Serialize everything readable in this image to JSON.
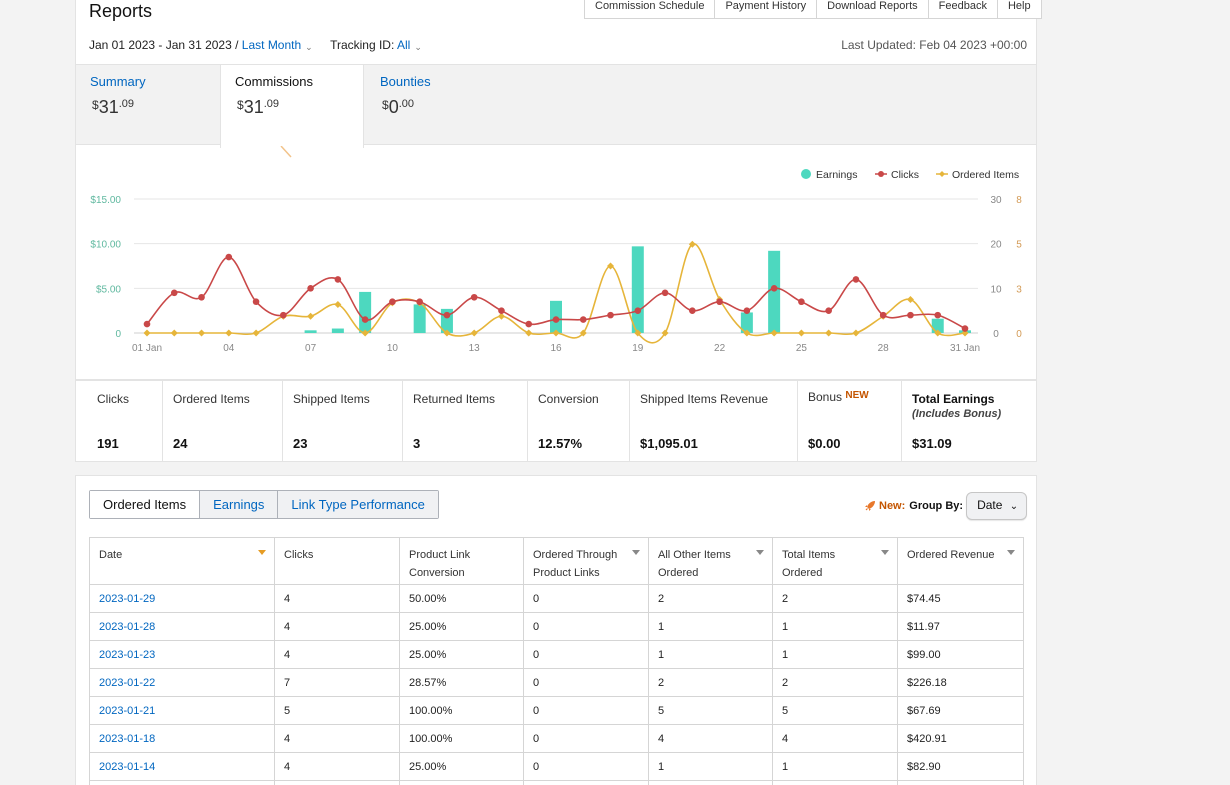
{
  "header": {
    "title": "Reports",
    "links": [
      "Commission Schedule",
      "Payment History",
      "Download Reports",
      "Feedback",
      "Help"
    ],
    "date_range": "Jan 01 2023 - Jan 31 2023 /",
    "date_preset": "Last Month",
    "tracking_label": "Tracking ID:",
    "tracking_value": "All",
    "last_updated": "Last Updated: Feb 04 2023 +00:00"
  },
  "summary_tabs": [
    {
      "label": "Summary",
      "currency": "$",
      "whole": "31",
      "cents": ".09"
    },
    {
      "label": "Commissions",
      "currency": "$",
      "whole": "31",
      "cents": ".09"
    },
    {
      "label": "Bounties",
      "currency": "$",
      "whole": "0",
      "cents": ".00"
    }
  ],
  "chart_data": {
    "type": "line",
    "legend": [
      "Earnings",
      "Clicks",
      "Ordered Items"
    ],
    "legend_position": "top-right",
    "x_tick_labels": [
      "01 Jan",
      "04",
      "07",
      "10",
      "13",
      "16",
      "19",
      "22",
      "25",
      "28",
      "31 Jan"
    ],
    "x": [
      1,
      2,
      3,
      4,
      5,
      6,
      7,
      8,
      9,
      10,
      11,
      12,
      13,
      14,
      15,
      16,
      17,
      18,
      19,
      20,
      21,
      22,
      23,
      24,
      25,
      26,
      27,
      28,
      29,
      30,
      31
    ],
    "y_left_ticks": [
      "$15.00",
      "$10.00",
      "$5.00",
      "0"
    ],
    "y_left_range": [
      0,
      15
    ],
    "y_right1_ticks": [
      "30",
      "20",
      "10",
      "0"
    ],
    "y_right1_range": [
      0,
      30
    ],
    "y_right2_ticks": [
      "8",
      "5",
      "3",
      "0"
    ],
    "y_right2_range": [
      0,
      8
    ],
    "grid": true,
    "series": [
      {
        "name": "Earnings",
        "type": "bar",
        "color": "#4dd8bf",
        "axis": "left",
        "values": [
          0,
          0,
          0,
          0,
          0,
          0,
          0.3,
          0.5,
          4.6,
          0,
          3.2,
          2.7,
          0,
          0,
          0,
          3.6,
          0,
          0,
          9.7,
          0,
          0,
          0,
          2.3,
          9.2,
          0,
          0,
          0,
          0,
          0,
          1.6,
          0.3
        ]
      },
      {
        "name": "Clicks",
        "type": "line",
        "color": "#c94848",
        "axis": "right1",
        "values": [
          2,
          9,
          8,
          17,
          7,
          4,
          10,
          12,
          3,
          7,
          7,
          4,
          8,
          5,
          2,
          3,
          3,
          4,
          5,
          9,
          5,
          7,
          5,
          10,
          7,
          5,
          12,
          4,
          4,
          4,
          1
        ]
      },
      {
        "name": "Ordered Items",
        "type": "line",
        "color": "#e6b53a",
        "axis": "right2",
        "values": [
          0,
          0,
          0,
          0,
          0,
          1,
          1,
          1.7,
          0,
          1.8,
          1.8,
          0,
          0,
          1,
          0,
          0,
          0,
          4,
          0,
          0,
          5.3,
          2,
          0,
          0,
          0,
          0,
          0,
          1,
          2,
          0,
          0
        ]
      }
    ]
  },
  "stats": [
    {
      "label": "Clicks",
      "value": "191"
    },
    {
      "label": "Ordered Items",
      "value": "24"
    },
    {
      "label": "Shipped Items",
      "value": "23"
    },
    {
      "label": "Returned Items",
      "value": "3"
    },
    {
      "label": "Conversion",
      "value": "12.57%"
    },
    {
      "label": "Shipped Items Revenue",
      "value": "$1,095.01"
    },
    {
      "label": "Bonus",
      "badge": "NEW",
      "value": "$0.00"
    },
    {
      "label": "Total Earnings",
      "sub": "(Includes Bonus)",
      "value": "$31.09"
    }
  ],
  "report_tabs": [
    "Ordered Items",
    "Earnings",
    "Link Type Performance"
  ],
  "group_by": {
    "new_label": "New:",
    "label": "Group By:",
    "value": "Date"
  },
  "table": {
    "headers": [
      [
        "Date"
      ],
      [
        "Clicks"
      ],
      [
        "Product Link",
        "Conversion"
      ],
      [
        "Ordered Through",
        "Product Links"
      ],
      [
        "All Other Items",
        "Ordered"
      ],
      [
        "Total Items",
        "Ordered"
      ],
      [
        "Ordered Revenue"
      ]
    ],
    "rows": [
      [
        "2023-01-29",
        "4",
        "50.00%",
        "0",
        "2",
        "2",
        "$74.45"
      ],
      [
        "2023-01-28",
        "4",
        "25.00%",
        "0",
        "1",
        "1",
        "$11.97"
      ],
      [
        "2023-01-23",
        "4",
        "25.00%",
        "0",
        "1",
        "1",
        "$99.00"
      ],
      [
        "2023-01-22",
        "7",
        "28.57%",
        "0",
        "2",
        "2",
        "$226.18"
      ],
      [
        "2023-01-21",
        "5",
        "100.00%",
        "0",
        "5",
        "5",
        "$67.69"
      ],
      [
        "2023-01-18",
        "4",
        "100.00%",
        "0",
        "4",
        "4",
        "$420.91"
      ],
      [
        "2023-01-14",
        "4",
        "25.00%",
        "0",
        "1",
        "1",
        "$82.90"
      ]
    ]
  }
}
